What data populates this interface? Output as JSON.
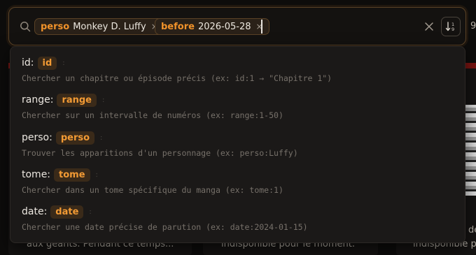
{
  "search": {
    "chips": [
      {
        "key": "perso",
        "value": "Monkey D. Luffy"
      },
      {
        "key": "before",
        "value": "2026-05-28"
      }
    ],
    "chip_remove_glyph": "×",
    "accent_color": "#f0922a"
  },
  "sort_button": {
    "icon": "sort-numeric-icon",
    "label": "↓½"
  },
  "suggestions": [
    {
      "label": "id:",
      "badge": "id",
      "description": "Chercher un chapitre ou épisode précis (ex: id:1 → \"Chapitre 1\")"
    },
    {
      "label": "range:",
      "badge": "range",
      "description": "Chercher sur un intervalle de numéros (ex: range:1-50)"
    },
    {
      "label": "perso:",
      "badge": "perso",
      "description": "Trouver les apparitions d'un personnage (ex: perso:Luffy)"
    },
    {
      "label": "tome:",
      "badge": "tome",
      "description": "Chercher dans un tome spécifique du manga (ex: tome:1)"
    },
    {
      "label": "date:",
      "badge": "date",
      "description": "Chercher une date précise de parution (ex: date:2024-01-15)"
    }
  ],
  "background": {
    "snippets": [
      "aux géants. Pendant ce temps...",
      "indisponible pour le moment.",
      "indisponible p",
      "de"
    ],
    "edge_text": "9"
  }
}
